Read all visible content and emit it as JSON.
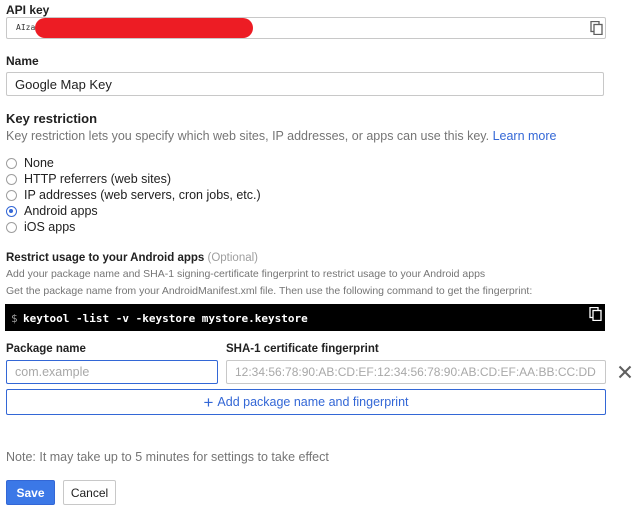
{
  "api_key": {
    "label": "API key",
    "value_prefix": "AIza"
  },
  "name": {
    "label": "Name",
    "value": "Google Map Key"
  },
  "key_restriction": {
    "title": "Key restriction",
    "description": "Key restriction lets you specify which web sites, IP addresses, or apps can use this key.",
    "learn_more": "Learn more",
    "options": [
      {
        "label": "None",
        "checked": false
      },
      {
        "label": "HTTP referrers (web sites)",
        "checked": false
      },
      {
        "label": "IP addresses (web servers, cron jobs, etc.)",
        "checked": false
      },
      {
        "label": "Android apps",
        "checked": true
      },
      {
        "label": "iOS apps",
        "checked": false
      }
    ]
  },
  "android": {
    "title": "Restrict usage to your Android apps",
    "optional": "(Optional)",
    "help_1": "Add your package name and SHA-1 signing-certificate fingerprint to restrict usage to your Android apps",
    "help_2": "Get the package name from your AndroidManifest.xml file. Then use the following command to get the fingerprint:",
    "command_prompt": "$",
    "command": "keytool -list -v -keystore mystore.keystore",
    "package_label": "Package name",
    "package_placeholder": "com.example",
    "sha_label": "SHA-1 certificate fingerprint",
    "sha_placeholder": "12:34:56:78:90:AB:CD:EF:12:34:56:78:90:AB:CD:EF:AA:BB:CC:DD",
    "add_button": "Add package name and fingerprint"
  },
  "note": "Note: It may take up to 5 minutes for settings to take effect",
  "buttons": {
    "save": "Save",
    "cancel": "Cancel"
  },
  "icons": {
    "copy": "copy-icon",
    "remove": "close-icon",
    "add": "plus-icon"
  },
  "colors": {
    "accent": "#3367d6",
    "primary_button": "#3b78e7",
    "redaction": "#ed1c24"
  }
}
